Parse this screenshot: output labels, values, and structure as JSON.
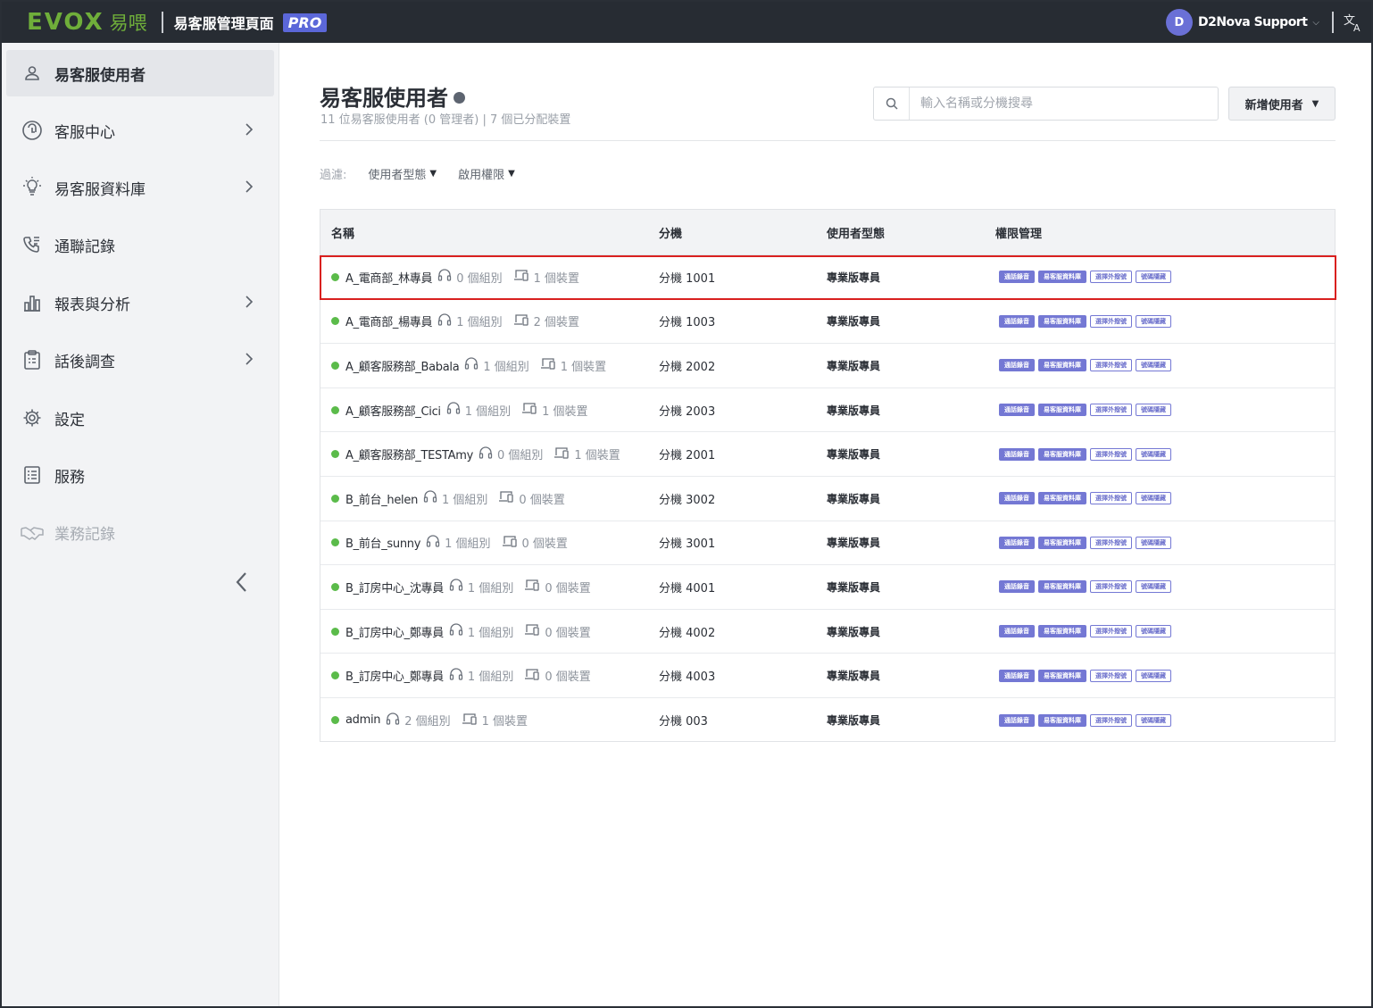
{
  "topbar": {
    "logo_text": "EVOX",
    "logo_cn": "易喂",
    "app_title": "易客服管理頁面",
    "pro_badge": "PRO",
    "user_initial": "D",
    "user_name": "D2Nova Support"
  },
  "sidebar": {
    "items": [
      {
        "label": "易客服使用者",
        "icon": "user-icon"
      },
      {
        "label": "客服中心",
        "icon": "headset-circle-icon"
      },
      {
        "label": "易客服資料庫",
        "icon": "lightbulb-icon"
      },
      {
        "label": "通聯記錄",
        "icon": "phone-list-icon"
      },
      {
        "label": "報表與分析",
        "icon": "bar-chart-icon"
      },
      {
        "label": "話後調查",
        "icon": "clipboard-icon"
      },
      {
        "label": "設定",
        "icon": "gear-icon"
      },
      {
        "label": "服務",
        "icon": "list-doc-icon"
      },
      {
        "label": "業務記錄",
        "icon": "handshake-icon"
      }
    ]
  },
  "page": {
    "title": "易客服使用者",
    "subtitle": "11 位易客服使用者 (0 管理者) | 7 個已分配裝置",
    "search_placeholder": "輸入名稱或分機搜尋",
    "add_user_label": "新增使用者"
  },
  "filters": {
    "label": "過濾:",
    "user_type": "使用者型態",
    "permission": "啟用權限"
  },
  "table": {
    "headers": {
      "name": "名稱",
      "ext": "分機",
      "type": "使用者型態",
      "perm": "權限管理"
    },
    "rows": [
      {
        "name": "A_電商部_林專員",
        "groups": "0 個組別",
        "devices": "1 個裝置",
        "ext": "分機 1001",
        "type": "專業版專員"
      },
      {
        "name": "A_電商部_楊專員",
        "groups": "1 個組別",
        "devices": "2 個裝置",
        "ext": "分機 1003",
        "type": "專業版專員"
      },
      {
        "name": "A_顧客服務部_Babala",
        "groups": "1 個組別",
        "devices": "1 個裝置",
        "ext": "分機 2002",
        "type": "專業版專員"
      },
      {
        "name": "A_顧客服務部_Cici",
        "groups": "1 個組別",
        "devices": "1 個裝置",
        "ext": "分機 2003",
        "type": "專業版專員"
      },
      {
        "name": "A_顧客服務部_TESTAmy",
        "groups": "0 個組別",
        "devices": "1 個裝置",
        "ext": "分機 2001",
        "type": "專業版專員"
      },
      {
        "name": "B_前台_helen",
        "groups": "1 個組別",
        "devices": "0 個裝置",
        "ext": "分機 3002",
        "type": "專業版專員"
      },
      {
        "name": "B_前台_sunny",
        "groups": "1 個組別",
        "devices": "0 個裝置",
        "ext": "分機 3001",
        "type": "專業版專員"
      },
      {
        "name": "B_訂房中心_沈專員",
        "groups": "1 個組別",
        "devices": "0 個裝置",
        "ext": "分機 4001",
        "type": "專業版專員"
      },
      {
        "name": "B_訂房中心_鄭專員",
        "groups": "1 個組別",
        "devices": "0 個裝置",
        "ext": "分機 4002",
        "type": "專業版專員"
      },
      {
        "name": "B_訂房中心_鄭專員",
        "groups": "1 個組別",
        "devices": "0 個裝置",
        "ext": "分機 4003",
        "type": "專業版專員"
      },
      {
        "name": "admin",
        "groups": "2 個組別",
        "devices": "1 個裝置",
        "ext": "分機 003",
        "type": "專業版專員"
      }
    ],
    "permission_tags": [
      {
        "label": "通話錄音",
        "style": "solid"
      },
      {
        "label": "易客服資料庫",
        "style": "solid"
      },
      {
        "label": "選擇外撥號",
        "style": "outline"
      },
      {
        "label": "號碼隱藏",
        "style": "outline"
      }
    ]
  },
  "colors": {
    "topbar_bg": "#272c33",
    "brand_green": "#6fae3a",
    "accent_purple": "#5b67d9",
    "status_online": "#5bbb4a",
    "highlight_red": "#d9201f"
  }
}
